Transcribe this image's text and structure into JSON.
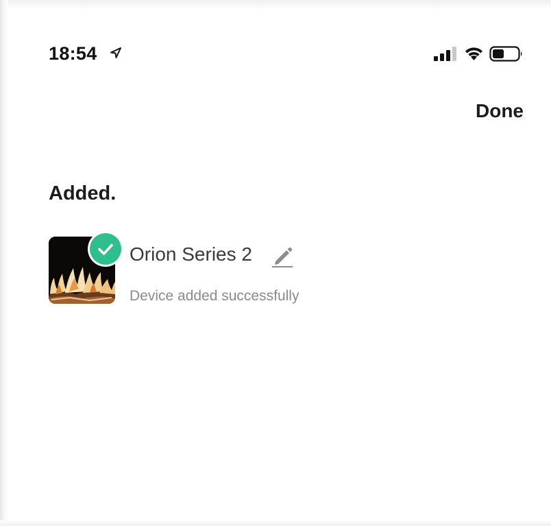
{
  "status_bar": {
    "time": "18:54",
    "icons": [
      "location-arrow-icon",
      "cellular-signal-icon",
      "wifi-icon",
      "battery-icon"
    ]
  },
  "nav": {
    "done_label": "Done"
  },
  "section": {
    "title": "Added."
  },
  "device": {
    "name": "Orion Series 2",
    "status": "Device added successfully",
    "thumbnail": "fireplace-flame-image",
    "badge_icon": "check-icon",
    "edit_icon": "pencil-icon"
  },
  "colors": {
    "badge": "#2dbf8e",
    "text_primary": "#1c1c1c",
    "text_secondary": "#8a8a8a"
  }
}
